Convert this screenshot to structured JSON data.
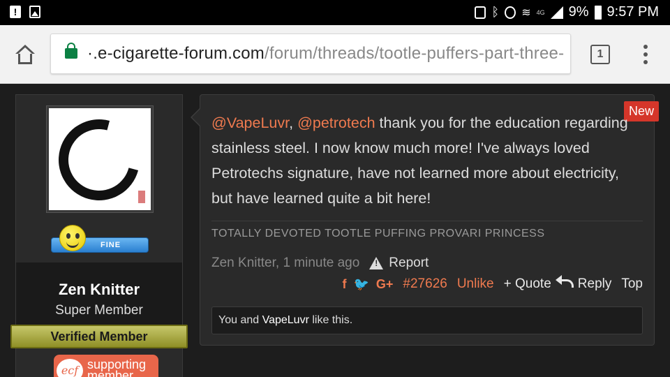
{
  "status_bar": {
    "network": "4G",
    "battery": "9%",
    "time": "9:57 PM"
  },
  "browser": {
    "url_host": "​.e-cigarette-forum.com",
    "url_host_display": "·.e-cigarette-forum.com",
    "url_path": "/forum/threads/tootle-puffers-part-three-",
    "tab_count": "1"
  },
  "user": {
    "badge_text": "FINE",
    "name": "Zen Knitter",
    "title": "Super Member",
    "verified_label": "Verified Member",
    "supporting_logo": "ecf",
    "supporting_line1": "supporting",
    "supporting_line2": "member"
  },
  "post": {
    "new_label": "New",
    "mention1": "@VapeLuvr",
    "separator": ",",
    "mention2": "@petrotech",
    "body_rest": " thank you for the education regarding stainless steel. I now know much more! I've always loved Petrotechs signature, have not learned more about electricity, but have learned quite a bit here!",
    "signature": "TOTALLY DEVOTED TOOTLE PUFFING PROVARI PRINCESS",
    "author_time": "Zen Knitter, 1 minute ago",
    "report_label": "Report",
    "share_icons": [
      "f",
      "🐦",
      "G+"
    ],
    "share_f": "f",
    "share_t": "♥",
    "share_g": "G+",
    "post_number": "#27626",
    "unlike_label": "Unlike",
    "quote_label": "+ Quote",
    "reply_label": "Reply",
    "top_label": "Top",
    "likes_prefix": "You and ",
    "likes_user": "VapeLuvr",
    "likes_suffix": " like this."
  },
  "colors": {
    "accent": "#ef7a4f",
    "new_badge": "#d5362a",
    "verified": "#8f8f26"
  }
}
